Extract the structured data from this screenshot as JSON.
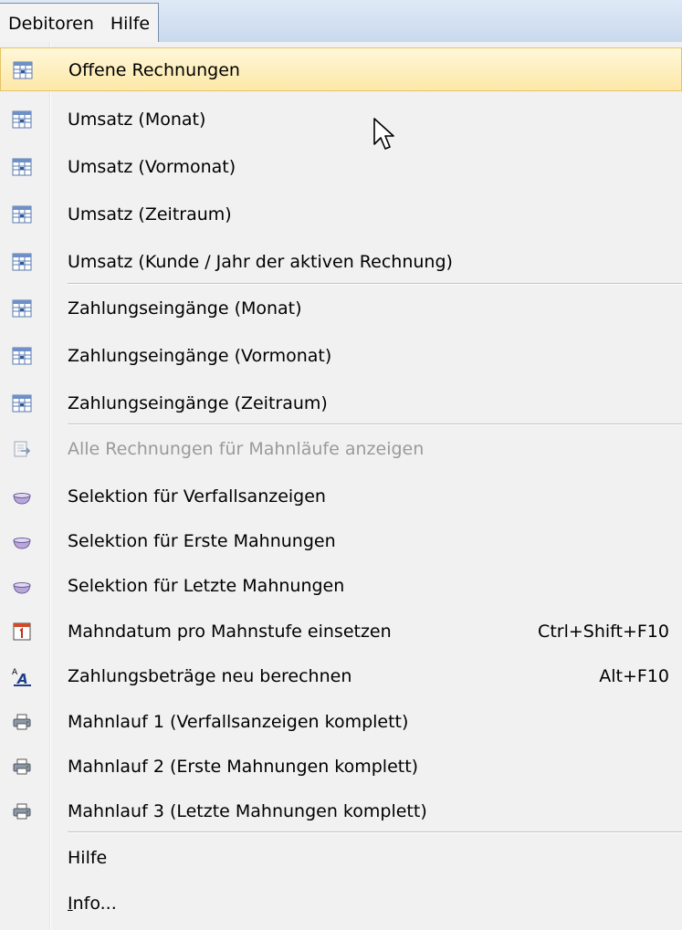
{
  "menubar": {
    "items": [
      "Debitoren",
      "Hilfe"
    ]
  },
  "menu": {
    "items": [
      {
        "label": "Offene Rechnungen",
        "icon": "table-grid-icon"
      },
      {
        "label": "Umsatz (Monat)",
        "icon": "table-grid-icon"
      },
      {
        "label": "Umsatz (Vormonat)",
        "icon": "table-grid-icon"
      },
      {
        "label": "Umsatz (Zeitraum)",
        "icon": "table-grid-icon"
      },
      {
        "label": "Umsatz (Kunde / Jahr der aktiven Rechnung)",
        "icon": "table-grid-icon"
      },
      {
        "label": "Zahlungseingänge (Monat)",
        "icon": "table-grid-icon"
      },
      {
        "label": "Zahlungseingänge (Vormonat)",
        "icon": "table-grid-icon"
      },
      {
        "label": "Zahlungseingänge (Zeitraum)",
        "icon": "table-grid-icon"
      },
      {
        "label": "Alle Rechnungen für Mahnläufe anzeigen",
        "icon": "document-arrow-icon",
        "disabled": true
      },
      {
        "label": "Selektion für Verfallsanzeigen",
        "icon": "bowl-icon"
      },
      {
        "label": "Selektion für Erste Mahnungen",
        "icon": "bowl-icon"
      },
      {
        "label": "Selektion für Letzte Mahnungen",
        "icon": "bowl-icon"
      },
      {
        "label": "Mahndatum pro Mahnstufe einsetzen",
        "icon": "calendar-icon",
        "shortcut": "Ctrl+Shift+F10"
      },
      {
        "label": "Zahlungsbeträge neu berechnen",
        "icon": "text-format-icon",
        "shortcut": "Alt+F10"
      },
      {
        "label": "Mahnlauf 1 (Verfallsanzeigen komplett)",
        "icon": "printer-icon"
      },
      {
        "label": "Mahnlauf 2 (Erste Mahnungen komplett)",
        "icon": "printer-icon"
      },
      {
        "label": "Mahnlauf 3 (Letzte Mahnungen komplett)",
        "icon": "printer-icon"
      },
      {
        "label": "Hilfe"
      },
      {
        "label_u": "I",
        "label_rest": "nfo..."
      }
    ]
  }
}
